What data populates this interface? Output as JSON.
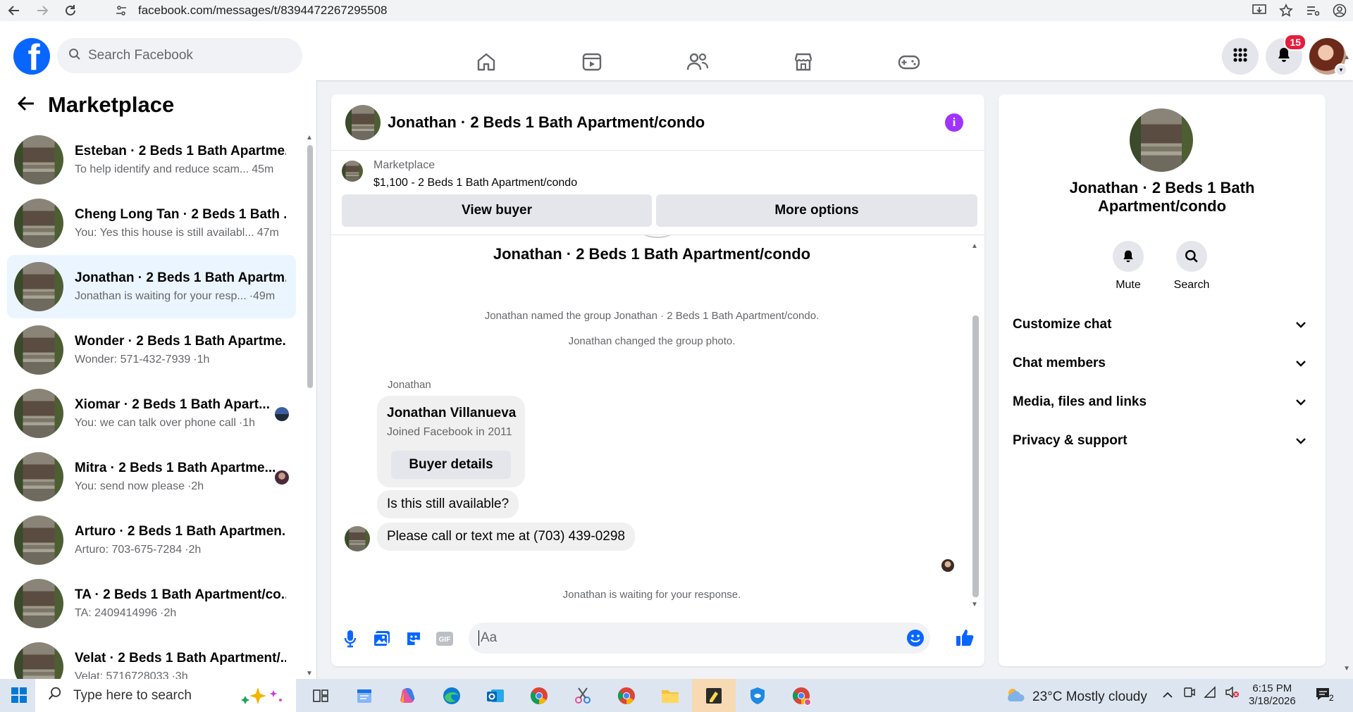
{
  "browser": {
    "url": "facebook.com/messages/t/8394472267295508"
  },
  "header": {
    "logo": "f",
    "search_placeholder": "Search Facebook",
    "notification_count": "15"
  },
  "sidebar": {
    "title": "Marketplace",
    "conversations": [
      {
        "title": "Esteban · 2 Beds 1 Bath Apartme...",
        "preview": "To help identify and reduce scam...",
        "time": "45m"
      },
      {
        "title": "Cheng Long Tan · 2 Beds 1 Bath ...",
        "preview": "You: Yes this house is still availabl...",
        "time": "47m"
      },
      {
        "title": "Jonathan · 2 Beds 1 Bath Apartm...",
        "preview": "Jonathan is waiting for your resp...",
        "time": "·49m"
      },
      {
        "title": "Wonder · 2 Beds 1 Bath Apartme...",
        "preview": "Wonder: 571-432-7939",
        "time": "·1h"
      },
      {
        "title": "Xiomar · 2 Beds 1 Bath Apart...",
        "preview": "You: we can talk over phone call",
        "time": "·1h"
      },
      {
        "title": "Mitra · 2 Beds 1 Bath Apartme...",
        "preview": "You: send now please",
        "time": "·2h"
      },
      {
        "title": "Arturo · 2 Beds 1 Bath Apartmen...",
        "preview": "Arturo: 703-675-7284",
        "time": "·2h"
      },
      {
        "title": "TA · 2 Beds 1 Bath Apartment/co...",
        "preview": "TA: 2409414996",
        "time": "·2h"
      },
      {
        "title": "Velat · 2 Beds 1 Bath Apartment/...",
        "preview": "Velat: 5716728033",
        "time": "·3h"
      }
    ]
  },
  "chat": {
    "title": "Jonathan · 2 Beds 1 Bath Apartment/condo",
    "marketplace_label": "Marketplace",
    "listing": "$1,100 - 2 Beds 1 Bath Apartment/condo",
    "view_buyer_label": "View buyer",
    "more_options_label": "More options",
    "group_title": "Jonathan · 2 Beds 1 Bath Apartment/condo",
    "system_messages": [
      "Jonathan named the group Jonathan · 2 Beds 1 Bath Apartment/condo.",
      "Jonathan changed the group photo."
    ],
    "sender_name": "Jonathan",
    "buyer_card": {
      "name": "Jonathan Villanueva",
      "joined": "Joined Facebook in 2011",
      "button_label": "Buyer details"
    },
    "messages": [
      "Is this still available?",
      "Please call or text me at (703) 439-0298"
    ],
    "waiting_text": "Jonathan is waiting for your response.",
    "composer_placeholder": "Aa"
  },
  "info_panel": {
    "title": "Jonathan · 2 Beds 1 Bath Apartment/condo",
    "actions": [
      {
        "label": "Mute"
      },
      {
        "label": "Search"
      }
    ],
    "sections": [
      {
        "label": "Customize chat"
      },
      {
        "label": "Chat members"
      },
      {
        "label": "Media, files and links"
      },
      {
        "label": "Privacy & support"
      }
    ]
  },
  "taskbar": {
    "search_placeholder": "Type here to search",
    "weather": "23°C  Mostly cloudy",
    "time": "6:15 PM",
    "date": "3/18/2026",
    "notification_count": "2"
  },
  "colors": {
    "fb_blue": "#0866ff",
    "active_conversation_bg": "#ebf5ff",
    "info_icon": "#a033ff",
    "badge_red": "#e41e3f"
  }
}
